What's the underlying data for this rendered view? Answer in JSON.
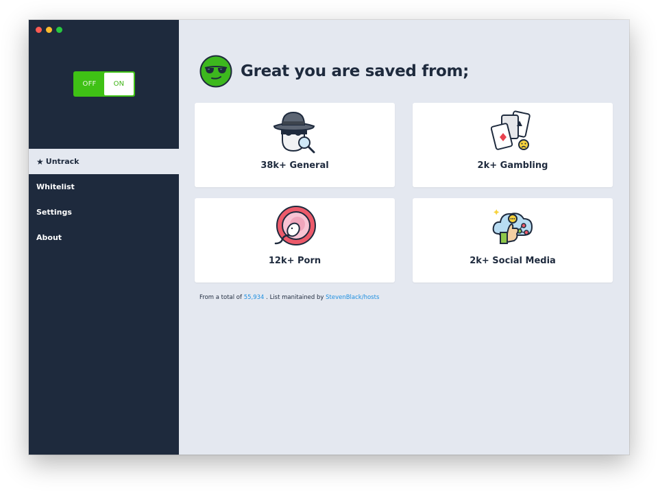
{
  "window": {
    "controls": [
      "close",
      "minimize",
      "maximize"
    ]
  },
  "toggle": {
    "off_label": "OFF",
    "on_label": "ON",
    "state": "ON"
  },
  "sidebar": {
    "items": [
      {
        "label": "Untrack",
        "active": true,
        "icon": "star-icon"
      },
      {
        "label": "Whitelist"
      },
      {
        "label": "Settings"
      },
      {
        "label": "About"
      }
    ]
  },
  "header": {
    "title": "Great you are saved from;",
    "icon": "sunglasses-face-icon"
  },
  "cards": [
    {
      "label": "38k+ General",
      "icon": "spy-hat-magnifier-icon"
    },
    {
      "label": "2k+ Gambling",
      "icon": "playing-cards-icon"
    },
    {
      "label": "12k+ Porn",
      "icon": "sperm-egg-icon"
    },
    {
      "label": "2k+ Social Media",
      "icon": "social-cloud-thumbs-up-icon"
    }
  ],
  "footer": {
    "prefix": "From a total of ",
    "total": "55,934",
    "middle": " . List manitained by ",
    "source": "StevenBlack/hosts"
  },
  "colors": {
    "sidebar": "#1e2a3d",
    "content_bg": "#e4e8f0",
    "toggle_green": "#3fc115",
    "link": "#1e8fe0"
  }
}
